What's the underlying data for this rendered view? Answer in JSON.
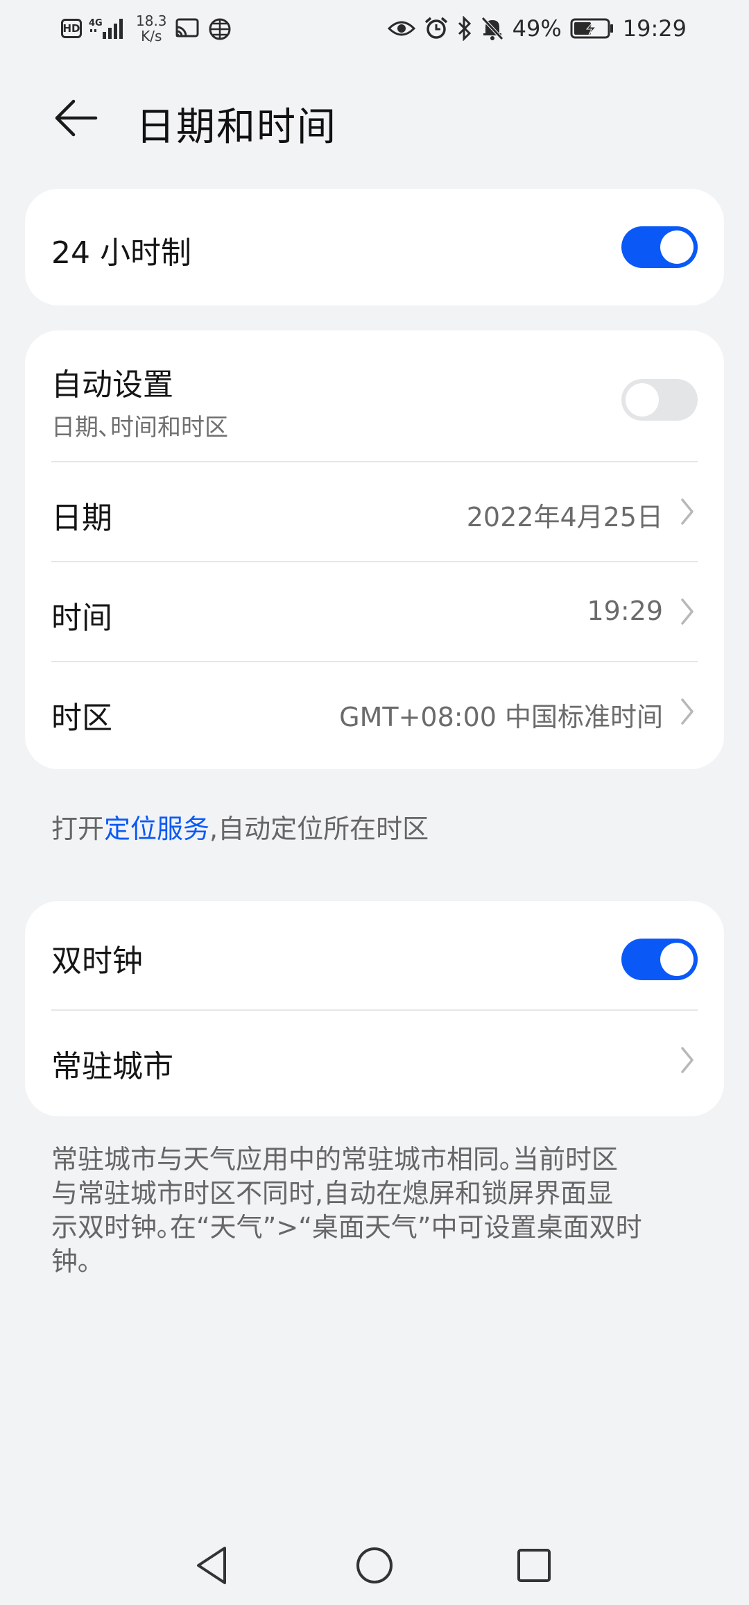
{
  "status_bar": {
    "hd": "HD",
    "network": "4G",
    "speed_value": "18.3",
    "speed_unit": "K/s",
    "battery": "49%",
    "time": "19:29"
  },
  "header": {
    "title": "日期和时间"
  },
  "card1": {
    "hour24_label": "24  小时制",
    "hour24_on": true
  },
  "card2": {
    "auto_label": "自动设置",
    "auto_sub": "日期､时间和时区",
    "auto_on": false,
    "date_label": "日期",
    "date_value": "2022年4月25日",
    "time_label": "时间",
    "time_value": "19:29",
    "tz_label": "时区",
    "tz_value": "GMT+08:00  中国标准时间"
  },
  "location_note": {
    "prefix": "打开",
    "link": "定位服务",
    "suffix": ",自动定位所在时区"
  },
  "card3": {
    "dual_label": "双时钟",
    "dual_on": true,
    "city_label": "常驻城市"
  },
  "dual_note": {
    "line1": "常驻城市与天气应用中的常驻城市相同｡当前时区",
    "line2": "与常驻城市时区不同时,自动在熄屏和锁屏界面显",
    "line3": "示双时钟｡在“天气”>“桌面天气”中可设置桌面双时",
    "line4": "钟｡"
  },
  "colors": {
    "accent": "#0a59f7",
    "background": "#f1f3f5",
    "card": "#ffffff"
  },
  "icons": [
    "hd-badge-icon",
    "signal-icon",
    "cast-icon",
    "vpn-icon",
    "eye-icon",
    "alarm-icon",
    "bluetooth-icon",
    "mute-icon",
    "battery-icon",
    "back-arrow-icon",
    "chevron-right-icon",
    "nav-back-icon",
    "nav-home-icon",
    "nav-recent-icon"
  ]
}
